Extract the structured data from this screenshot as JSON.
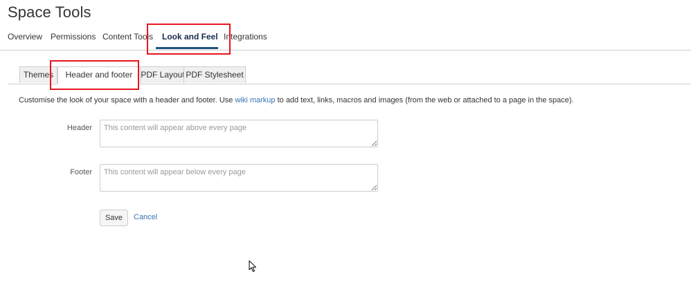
{
  "page": {
    "title": "Space Tools"
  },
  "topnav": {
    "items": [
      {
        "label": "Overview"
      },
      {
        "label": "Permissions"
      },
      {
        "label": "Content Tools"
      },
      {
        "label": "Look and Feel"
      },
      {
        "label": "Integrations"
      }
    ],
    "active": "Look and Feel"
  },
  "subtabs": {
    "items": [
      {
        "label": "Themes"
      },
      {
        "label": "Header and footer"
      },
      {
        "label": "PDF Layout"
      },
      {
        "label": "PDF Stylesheet"
      }
    ],
    "active": "Header and footer"
  },
  "description": {
    "before": "Customise the look of your space with a header and footer. Use ",
    "link": "wiki markup",
    "after": " to add text, links, macros and images (from the web or attached to a page in the space)."
  },
  "form": {
    "header": {
      "label": "Header",
      "value": "",
      "placeholder": "This content will appear above every page"
    },
    "footer": {
      "label": "Footer",
      "value": "",
      "placeholder": "This content will appear below every page"
    },
    "save_label": "Save",
    "cancel_label": "Cancel"
  },
  "colors": {
    "link": "#3572b0",
    "active_underline": "#205081",
    "highlight_box": "#e8141d"
  },
  "icons": {
    "cursor": "mouse-pointer-icon"
  }
}
